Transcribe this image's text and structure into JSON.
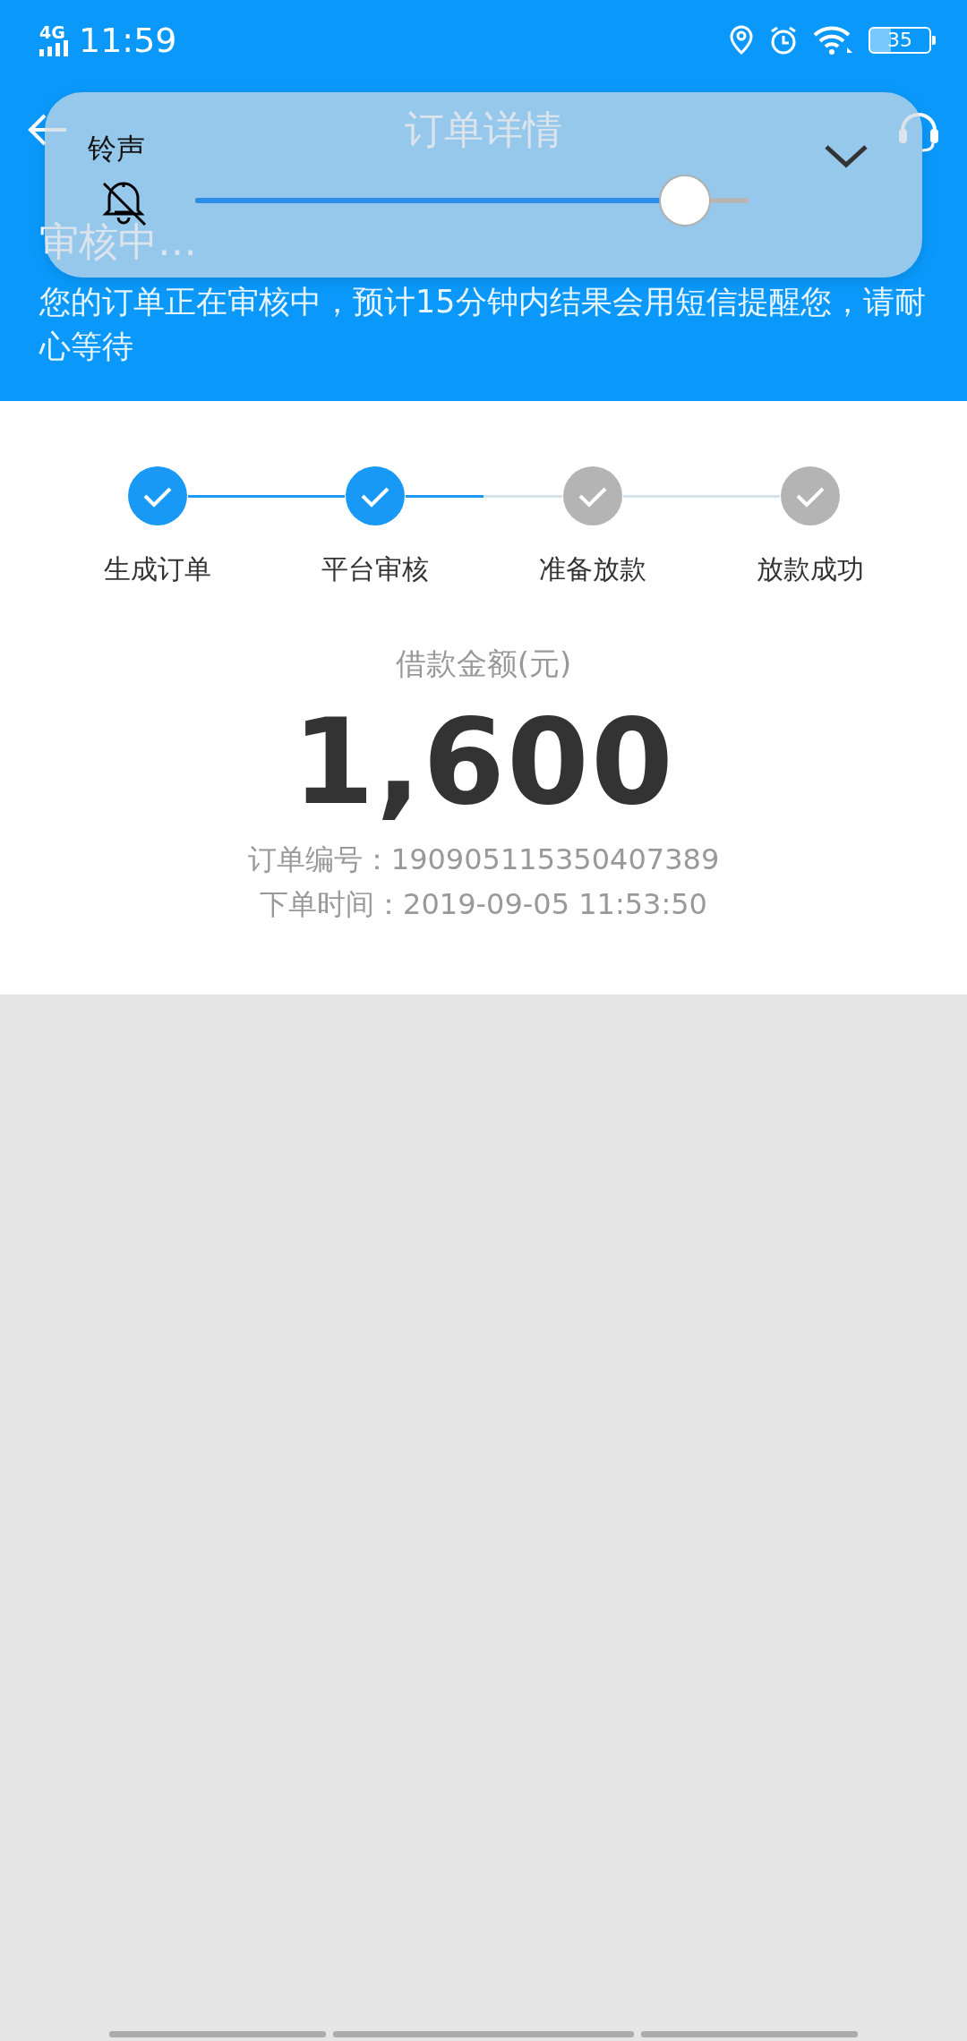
{
  "status_bar": {
    "network": "4G",
    "time": "11:59",
    "battery": "35"
  },
  "header": {
    "title": "订单详情",
    "status": "审核中…",
    "message": "您的订单正在审核中，预计15分钟内结果会用短信提醒您，请耐心等待"
  },
  "volume_panel": {
    "label": "铃声",
    "muted": true,
    "level": 0.885
  },
  "steps": [
    {
      "label": "生成订单",
      "done": true
    },
    {
      "label": "平台审核",
      "done": true
    },
    {
      "label": "准备放款",
      "done": false
    },
    {
      "label": "放款成功",
      "done": false
    }
  ],
  "loan": {
    "amount_label": "借款金额(元)",
    "amount": "1,600",
    "order_no_label": "订单编号：",
    "order_no": "190905115350407389",
    "time_label": "下单时间：",
    "time": "2019-09-05 11:53:50"
  }
}
